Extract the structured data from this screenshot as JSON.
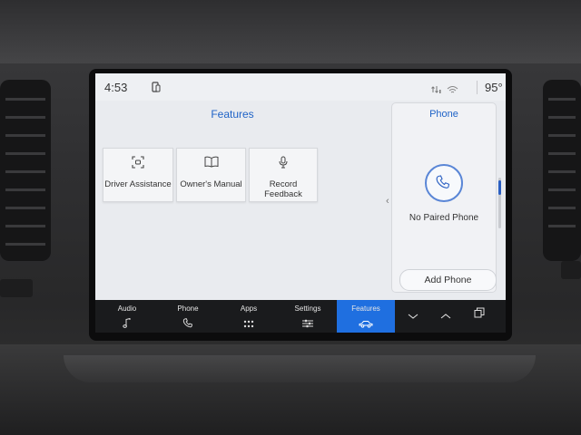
{
  "status_bar": {
    "time": "4:53",
    "temperature": "95°"
  },
  "features": {
    "title": "Features",
    "tiles": [
      {
        "label": "Driver Assistance",
        "icon": "driver-assist-icon"
      },
      {
        "label": "Owner's Manual",
        "icon": "book-icon"
      },
      {
        "label": "Record Feedback",
        "icon": "microphone-icon"
      }
    ]
  },
  "phone_panel": {
    "title": "Phone",
    "status": "No Paired Phone",
    "add_button": "Add Phone",
    "icon": "phone-icon"
  },
  "nav": {
    "items": [
      {
        "label": "Audio",
        "icon": "music-note-icon"
      },
      {
        "label": "Phone",
        "icon": "phone-icon"
      },
      {
        "label": "Apps",
        "icon": "grid-icon"
      },
      {
        "label": "Settings",
        "icon": "sliders-icon"
      },
      {
        "label": "Features",
        "icon": "car-icon"
      }
    ],
    "active": "Features",
    "active_color": "#1f6fe0"
  },
  "colors": {
    "accent": "#1f63c7",
    "screen_bg": "#e9ebef",
    "nav_bg": "#1a1b1d"
  }
}
